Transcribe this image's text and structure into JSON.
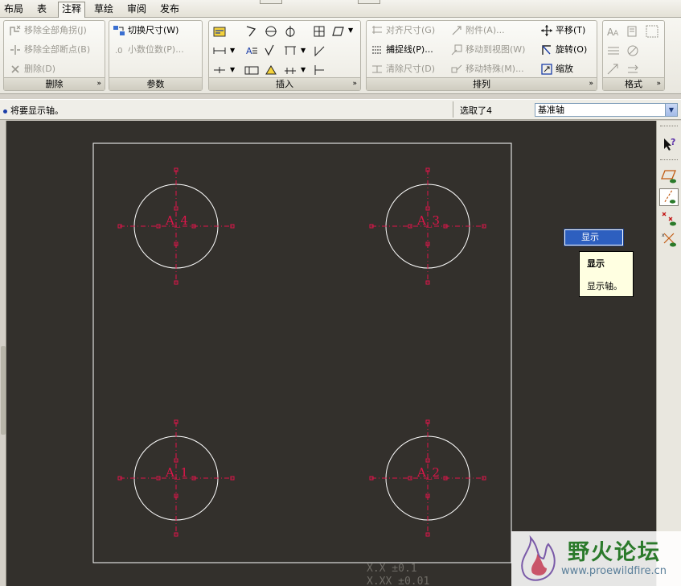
{
  "menu": {
    "tabs": [
      {
        "label": "布局"
      },
      {
        "label": "表"
      },
      {
        "label": "注释"
      },
      {
        "label": "草绘"
      },
      {
        "label": "审阅"
      },
      {
        "label": "发布"
      }
    ],
    "active_tab": "注释"
  },
  "ribbon": {
    "groups": {
      "delete": {
        "title": "删除",
        "items": [
          "移除全部角拐(J)",
          "移除全部断点(B)",
          "删除(D)"
        ]
      },
      "params": {
        "title": "参数",
        "items": [
          "切换尺寸(W)",
          "小数位数(P)..."
        ]
      },
      "insert": {
        "title": "插入"
      },
      "arrange": {
        "title": "排列",
        "items": [
          "对齐尺寸(G)",
          "附件(A)...",
          "平移(T)",
          "捕捉线(P)...",
          "移动到视图(W)",
          "旋转(O)",
          "清除尺寸(D)",
          "移动特殊(M)...",
          "缩放"
        ]
      },
      "format": {
        "title": "格式"
      }
    }
  },
  "status": {
    "message": "将要显示轴。",
    "selection_count": "选取了4",
    "filter_value": "基准轴"
  },
  "drawing": {
    "axes": [
      {
        "label": "A_4"
      },
      {
        "label": "A_3"
      },
      {
        "label": "A_1"
      },
      {
        "label": "A_2"
      }
    ],
    "tolerance_lines": [
      "X.X     ±0.1",
      "X.XX    ±0.01"
    ]
  },
  "popup": {
    "button_label": "显示",
    "tooltip_title": "显示",
    "tooltip_body": "显示轴。"
  },
  "watermark": {
    "title": "野火论坛",
    "url": "www.proewildfire.cn"
  },
  "colors": {
    "canvas": "#33302c",
    "sheet_border": "#ffffff",
    "axis_red": "#e0154a",
    "selection_blue": "#2d5fbf"
  }
}
